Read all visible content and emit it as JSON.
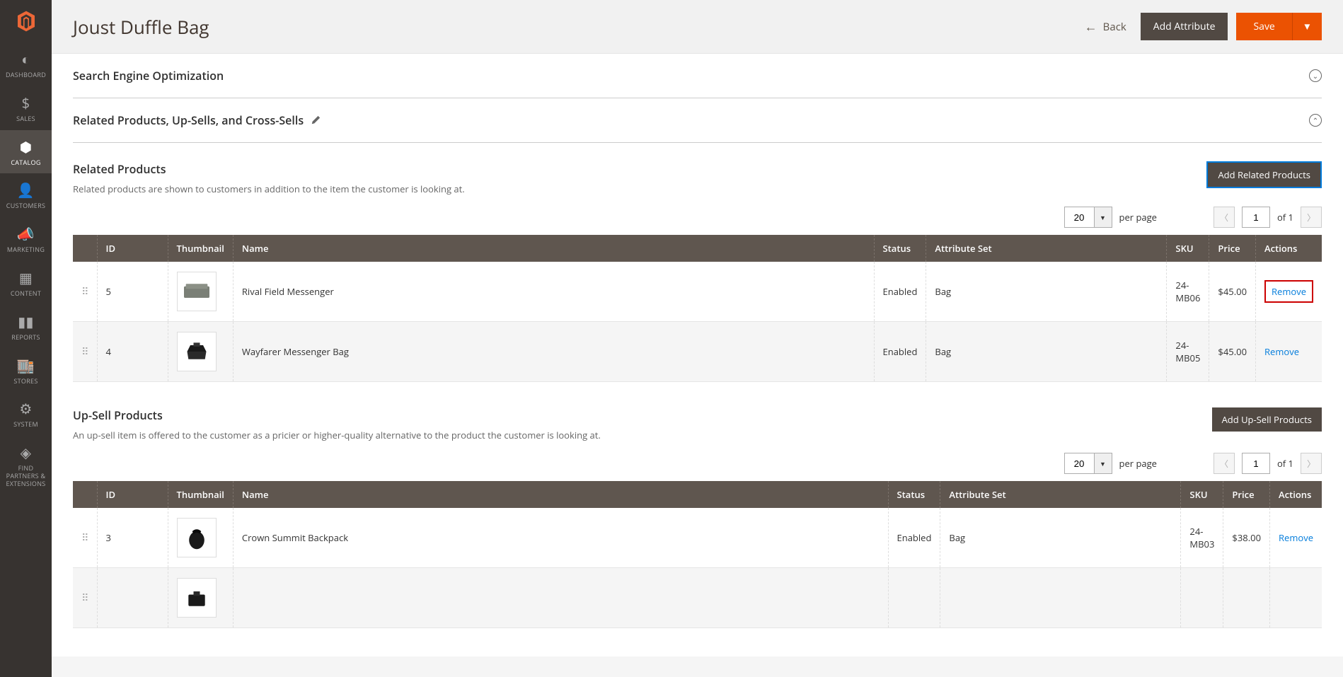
{
  "page_title": "Joust Duffle Bag",
  "header": {
    "back": "Back",
    "add_attribute": "Add Attribute",
    "save": "Save"
  },
  "sidebar": {
    "items": [
      {
        "label": "DASHBOARD"
      },
      {
        "label": "SALES"
      },
      {
        "label": "CATALOG"
      },
      {
        "label": "CUSTOMERS"
      },
      {
        "label": "MARKETING"
      },
      {
        "label": "CONTENT"
      },
      {
        "label": "REPORTS"
      },
      {
        "label": "STORES"
      },
      {
        "label": "SYSTEM"
      },
      {
        "label": "FIND PARTNERS & EXTENSIONS"
      }
    ]
  },
  "sections": {
    "seo": "Search Engine Optimization",
    "related": "Related Products, Up-Sells, and Cross-Sells"
  },
  "related": {
    "title": "Related Products",
    "desc": "Related products are shown to customers in addition to the item the customer is looking at.",
    "add_btn": "Add Related Products",
    "pager": {
      "page_size": "20",
      "per_page": "per page",
      "page": "1",
      "of": "of 1"
    },
    "headers": {
      "id": "ID",
      "thumbnail": "Thumbnail",
      "name": "Name",
      "status": "Status",
      "attrset": "Attribute Set",
      "sku": "SKU",
      "price": "Price",
      "actions": "Actions"
    },
    "rows": [
      {
        "id": "5",
        "name": "Rival Field Messenger",
        "status": "Enabled",
        "attrset": "Bag",
        "sku": "24-MB06",
        "price": "$45.00",
        "action": "Remove",
        "highlight": true
      },
      {
        "id": "4",
        "name": "Wayfarer Messenger Bag",
        "status": "Enabled",
        "attrset": "Bag",
        "sku": "24-MB05",
        "price": "$45.00",
        "action": "Remove",
        "highlight": false
      }
    ]
  },
  "upsell": {
    "title": "Up-Sell Products",
    "desc": "An up-sell item is offered to the customer as a pricier or higher-quality alternative to the product the customer is looking at.",
    "add_btn": "Add Up-Sell Products",
    "pager": {
      "page_size": "20",
      "per_page": "per page",
      "page": "1",
      "of": "of 1"
    },
    "headers": {
      "id": "ID",
      "thumbnail": "Thumbnail",
      "name": "Name",
      "status": "Status",
      "attrset": "Attribute Set",
      "sku": "SKU",
      "price": "Price",
      "actions": "Actions"
    },
    "rows": [
      {
        "id": "3",
        "name": "Crown Summit Backpack",
        "status": "Enabled",
        "attrset": "Bag",
        "sku": "24-MB03",
        "price": "$38.00",
        "action": "Remove"
      }
    ]
  }
}
